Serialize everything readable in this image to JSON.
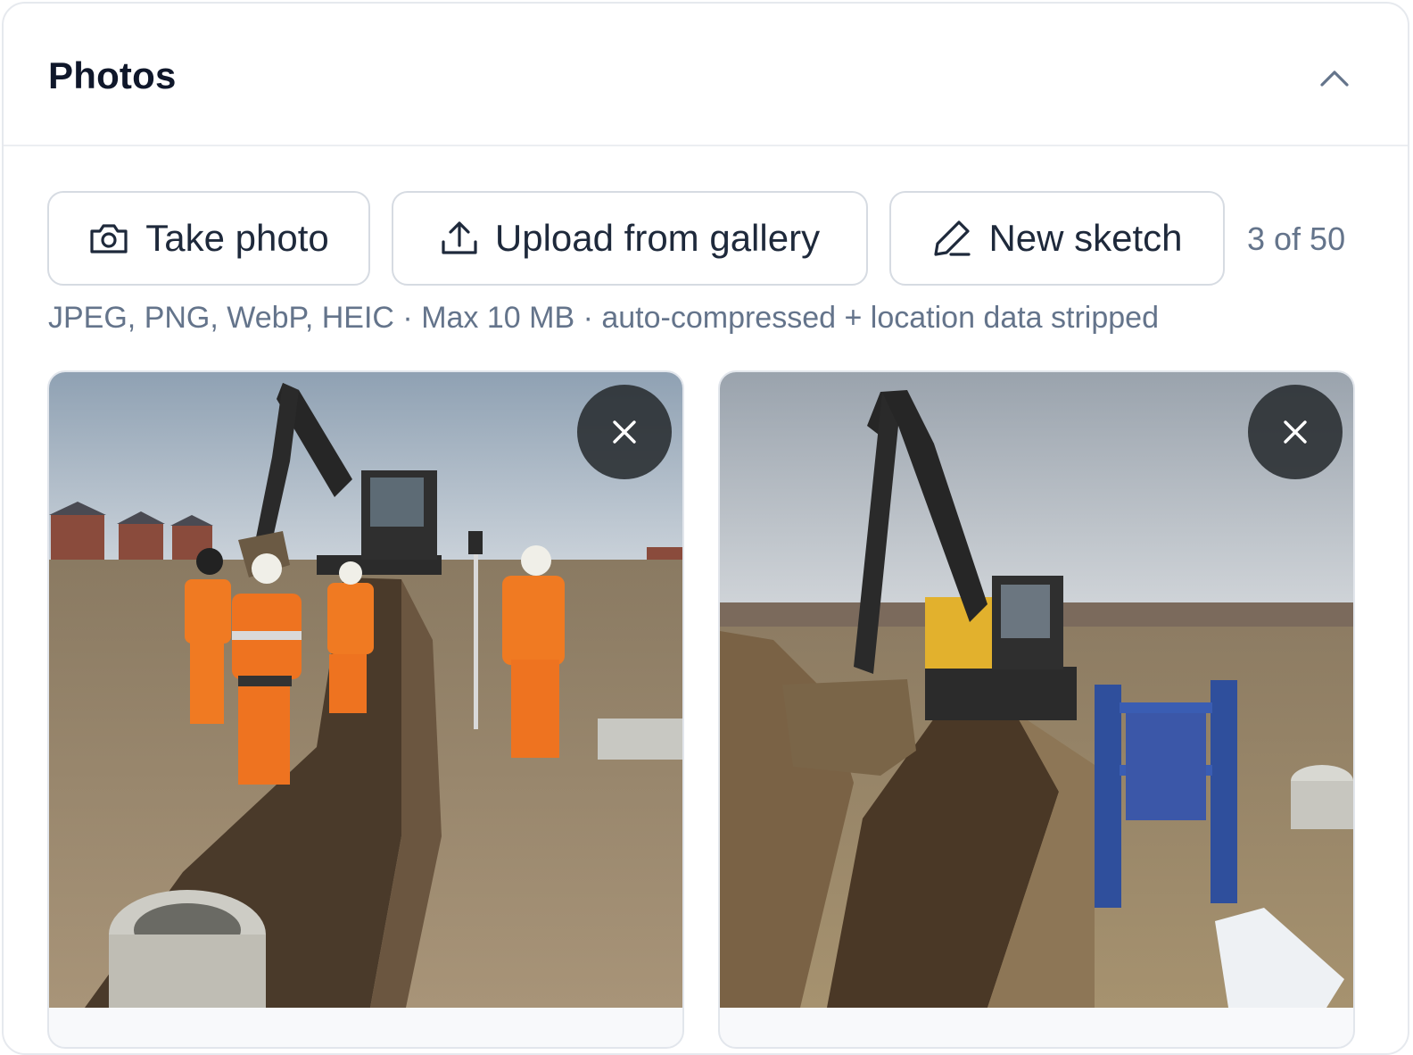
{
  "panel": {
    "title": "Photos",
    "collapse_icon": "chevron-up-icon"
  },
  "actions": {
    "take_photo": {
      "label": "Take photo",
      "icon": "camera-icon"
    },
    "upload": {
      "label": "Upload from gallery",
      "icon": "upload-icon"
    },
    "sketch": {
      "label": "New sketch",
      "icon": "pencil-icon"
    }
  },
  "counter": "3 of 50",
  "hint": "JPEG, PNG, WebP, HEIC · Max 10 MB · auto-compressed + location data stripped",
  "photos": [
    {
      "remove_icon": "close-icon"
    },
    {
      "remove_icon": "close-icon"
    }
  ]
}
